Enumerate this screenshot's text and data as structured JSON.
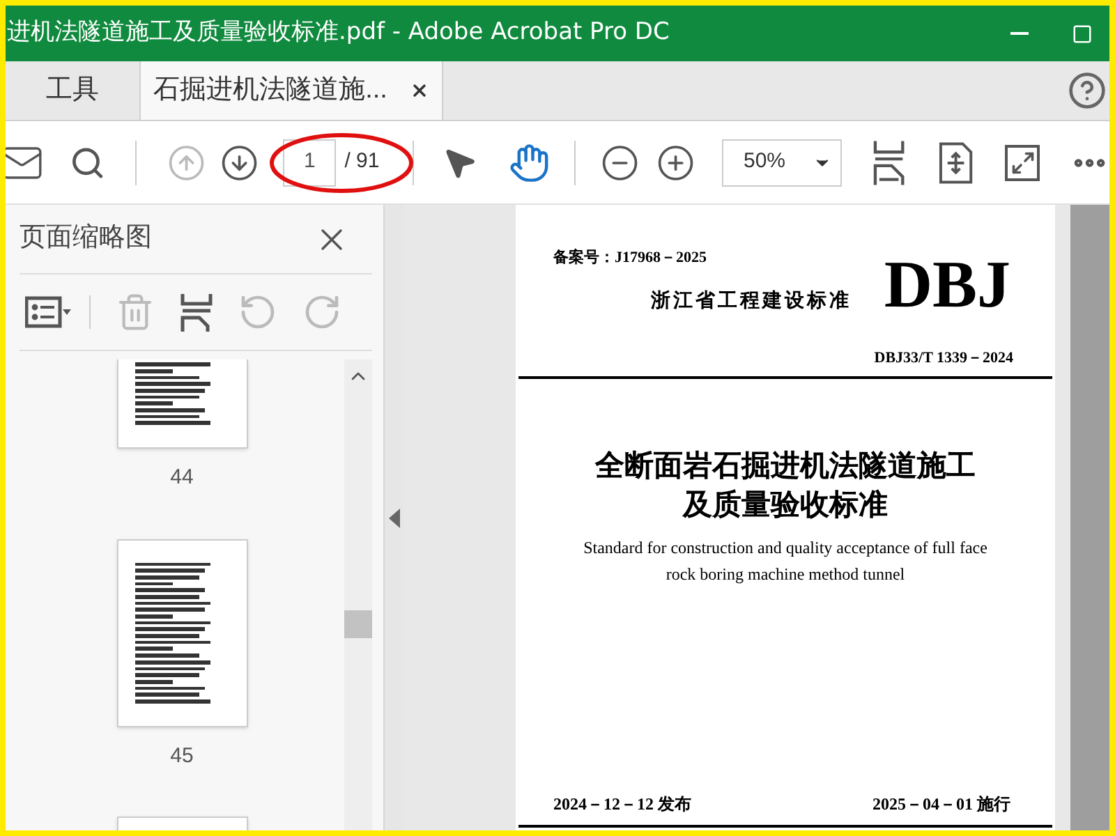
{
  "window": {
    "title": "进机法隧道施工及质量验收标准.pdf - Adobe Acrobat Pro DC"
  },
  "tabs": [
    {
      "label": "工具",
      "selected": false,
      "closable": false
    },
    {
      "label": "石掘进机法隧道施...",
      "selected": true,
      "closable": true
    }
  ],
  "toolbar": {
    "prev_page": {
      "disabled": true
    },
    "next_page": {
      "disabled": false
    },
    "page_number": "1",
    "page_count": "/ 91",
    "tools": [
      {
        "kind": "select",
        "selected": false
      },
      {
        "kind": "hand",
        "selected": true
      }
    ],
    "zoom": "50%"
  },
  "sidebar": {
    "title": "页面缩略图",
    "actions": [
      {
        "kind": "options",
        "disabled": false
      },
      {
        "kind": "delete",
        "disabled": true
      },
      {
        "kind": "extract",
        "disabled": false
      },
      {
        "kind": "rotate-left",
        "disabled": true
      },
      {
        "kind": "rotate-right",
        "disabled": true
      }
    ],
    "thumbnails": [
      {
        "label": "44",
        "cut": true
      },
      {
        "label": "45",
        "cut": false
      }
    ]
  },
  "document": {
    "record_number": "备案号：J17968－2025",
    "issuer": "浙江省工程建设标准",
    "logo": "DBJ",
    "code": "DBJ33/T 1339－2024",
    "title_lines": [
      "全断面岩石掘进机法隧道施工",
      "及质量验收标准"
    ],
    "subtitle_lines": [
      "Standard for construction and quality acceptance of full face",
      "rock boring machine method tunnel"
    ],
    "issued": "2024－12－12 发布",
    "effective": "2025－04－01 施行"
  }
}
